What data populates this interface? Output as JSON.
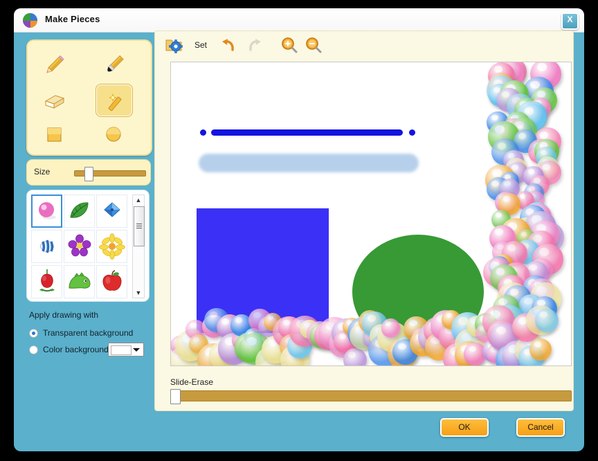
{
  "window": {
    "title": "Make Pieces",
    "app_icon": "app-logo-icon",
    "close_label": "X"
  },
  "tools": {
    "items": [
      {
        "name": "pencil-tool",
        "icon": "pencil-icon",
        "selected": false
      },
      {
        "name": "brush-tool",
        "icon": "paintbrush-icon",
        "selected": false
      },
      {
        "name": "eraser-tool",
        "icon": "eraser-icon",
        "selected": false
      },
      {
        "name": "magic-wand-tool",
        "icon": "magic-wand-icon",
        "selected": true
      },
      {
        "name": "square-tool",
        "icon": "square-icon",
        "selected": false
      },
      {
        "name": "circle-tool",
        "icon": "circle-icon",
        "selected": false
      }
    ]
  },
  "size": {
    "label": "Size",
    "value_percent": 14
  },
  "stickers": {
    "selected_index": 0,
    "items": [
      {
        "name": "bubble-sticker",
        "icon": "pink-bubble-icon"
      },
      {
        "name": "leaf-sticker",
        "icon": "green-leaf-icon"
      },
      {
        "name": "pushpin-sticker",
        "icon": "blue-pushpin-icon"
      },
      {
        "name": "fish-sticker",
        "icon": "blue-fish-icon"
      },
      {
        "name": "violet-sticker",
        "icon": "purple-flower-icon"
      },
      {
        "name": "sunflower-sticker",
        "icon": "yellow-flower-icon"
      },
      {
        "name": "strawberry-sticker",
        "icon": "red-strawberry-icon"
      },
      {
        "name": "dinosaur-sticker",
        "icon": "green-dinosaur-icon"
      },
      {
        "name": "apple-sticker",
        "icon": "red-apple-icon"
      }
    ],
    "scrollbar": {
      "up_arrow": "▲",
      "down_arrow": "▼"
    }
  },
  "apply": {
    "title": "Apply drawing with",
    "transparent_label": "Transparent background",
    "color_label": "Color background",
    "selected": "transparent",
    "color_value": "#ffffff"
  },
  "toolbar": {
    "set_label": "Set",
    "set_icon": "settings-gear-icon",
    "undo_icon": "undo-arrow-icon",
    "redo_icon": "redo-arrow-icon",
    "redo_disabled": true,
    "zoom_in_icon": "zoom-in-icon",
    "zoom_out_icon": "zoom-out-icon"
  },
  "erase": {
    "label": "Slide-Erase",
    "value_percent": 0
  },
  "buttons": {
    "ok_label": "OK",
    "cancel_label": "Cancel"
  },
  "colors": {
    "window_body": "#5BB0CC",
    "panel_cream": "#fbf8e3",
    "tool_panel": "#fdf6cd",
    "accent_orange": "#f79f16",
    "pencil_stroke": "#1414e0",
    "brush_stroke": "#b3cdea",
    "rectangle": "#3b30f5",
    "circle": "#379a35",
    "slider_track": "#c79a3e",
    "close_button": "#4d9fbd"
  },
  "canvas": {
    "marks": [
      {
        "name": "pencil-stroke",
        "type": "line",
        "color": "#1414e0"
      },
      {
        "name": "pencil-dot-left",
        "type": "dot",
        "color": "#1414e0"
      },
      {
        "name": "pencil-dot-right",
        "type": "dot",
        "color": "#1414e0"
      },
      {
        "name": "brush-stroke",
        "type": "soft-line",
        "color": "#b3cdea"
      },
      {
        "name": "rectangle-shape",
        "type": "rect",
        "color": "#3b30f5"
      },
      {
        "name": "circle-shape",
        "type": "ellipse",
        "color": "#379a35"
      },
      {
        "name": "balloon-column",
        "type": "stamps",
        "color": "multi"
      },
      {
        "name": "balloon-band",
        "type": "stamps",
        "color": "multi"
      }
    ],
    "balloon_palette": [
      "#ef7fc4",
      "#64c2ef",
      "#63c23f",
      "#f0a32b",
      "#b58bd8",
      "#e8de8e",
      "#3a86e8",
      "#f26fa8"
    ]
  }
}
